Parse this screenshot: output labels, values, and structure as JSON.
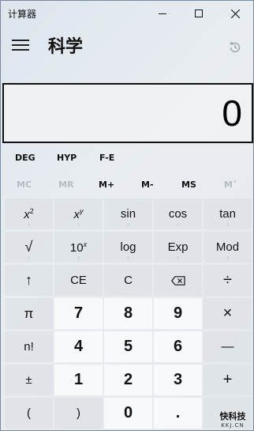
{
  "window": {
    "title": "计算器"
  },
  "header": {
    "mode_title": "科学"
  },
  "display": {
    "value": "0"
  },
  "modes": {
    "angle": "DEG",
    "hyp": "HYP",
    "fe": "F-E"
  },
  "memory": {
    "mc": "MC",
    "mr": "MR",
    "mplus": "M+",
    "mminus": "M-",
    "ms": "MS",
    "mlist": "M˅"
  },
  "keys": {
    "x2_base": "x",
    "x2_exp": "2",
    "xy_base": "x",
    "xy_exp": "y",
    "sin": "sin",
    "cos": "cos",
    "tan": "tan",
    "sqrt": "√",
    "tenx_base": "10",
    "tenx_exp": "x",
    "log": "log",
    "exp": "Exp",
    "mod": "Mod",
    "shift": "↑",
    "ce": "CE",
    "c": "C",
    "backspace": "⌫",
    "divide": "÷",
    "pi": "π",
    "seven": "7",
    "eight": "8",
    "nine": "9",
    "multiply": "×",
    "factorial": "n!",
    "four": "4",
    "five": "5",
    "six": "6",
    "minus": "—",
    "negate": "±",
    "one": "1",
    "two": "2",
    "three": "3",
    "plus": "+",
    "lparen": "(",
    "rparen": ")",
    "zero": "0",
    "decimal": "."
  },
  "watermark": {
    "top": "快科技",
    "bottom": "KKJ.CN"
  }
}
